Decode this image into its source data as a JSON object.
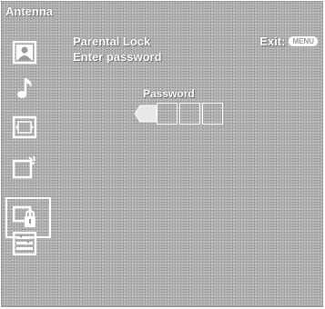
{
  "header": {
    "source": "Antenna"
  },
  "sidebar": {
    "icons": [
      {
        "name": "picture-icon"
      },
      {
        "name": "sound-icon"
      },
      {
        "name": "screen-icon"
      },
      {
        "name": "features-icon"
      },
      {
        "name": "parental-lock-icon",
        "selected": true
      },
      {
        "name": "setup-icon"
      }
    ]
  },
  "main": {
    "title": "Parental Lock",
    "subtitle": "Enter password",
    "exit_label": "Exit:",
    "menu_key": "MENU",
    "password_label": "Password",
    "password_digits": 4,
    "active_digit": 1
  }
}
